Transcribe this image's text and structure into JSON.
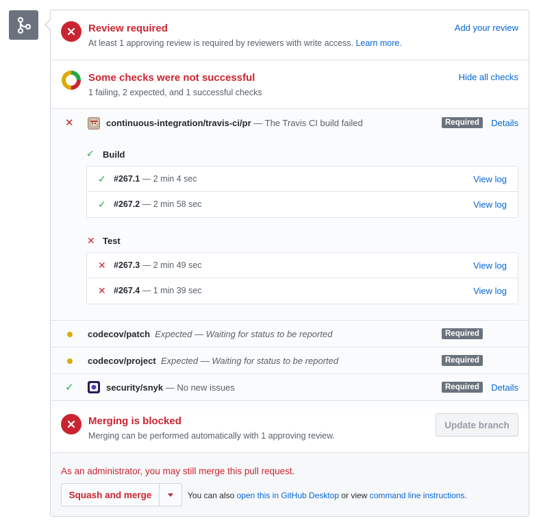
{
  "review": {
    "title": "Review required",
    "subtitle": "At least 1 approving review is required by reviewers with write access.",
    "learn_more": "Learn more.",
    "action": "Add your review"
  },
  "checks_summary": {
    "title": "Some checks were not successful",
    "subtitle": "1 failing, 2 expected, and 1 successful checks",
    "action": "Hide all checks"
  },
  "checks": {
    "travis": {
      "name": "continuous-integration/travis-ci/pr",
      "description": "— The Travis CI build failed",
      "badge": "Required",
      "details": "Details",
      "groups": [
        {
          "label": "Build",
          "jobs": [
            {
              "number": "#267.1",
              "duration": "— 2 min 4 sec",
              "link": "View log"
            },
            {
              "number": "#267.2",
              "duration": "— 2 min 58 sec",
              "link": "View log"
            }
          ]
        },
        {
          "label": "Test",
          "jobs": [
            {
              "number": "#267.3",
              "duration": "— 2 min 49 sec",
              "link": "View log"
            },
            {
              "number": "#267.4",
              "duration": "— 1 min 39 sec",
              "link": "View log"
            }
          ]
        }
      ]
    },
    "codecov_patch": {
      "name": "codecov/patch",
      "description": "Expected — Waiting for status to be reported",
      "badge": "Required"
    },
    "codecov_project": {
      "name": "codecov/project",
      "description": "Expected — Waiting for status to be reported",
      "badge": "Required"
    },
    "snyk": {
      "name": "security/snyk",
      "description": "— No new issues",
      "badge": "Required",
      "details": "Details"
    }
  },
  "merging": {
    "title": "Merging is blocked",
    "subtitle": "Merging can be performed automatically with 1 approving review.",
    "update_button": "Update branch"
  },
  "footer": {
    "admin_note": "As an administrator, you may still merge this pull request.",
    "merge_button": "Squash and merge",
    "alt_prefix": "You can also",
    "desktop_link": "open this in GitHub Desktop",
    "alt_middle": "or view",
    "cli_link": "command line instructions",
    "alt_suffix": "."
  },
  "colors": {
    "failure": "#cb2431",
    "success": "#28a745",
    "pending": "#dbab09",
    "link": "#0366d6",
    "badge": "#6a737d"
  }
}
